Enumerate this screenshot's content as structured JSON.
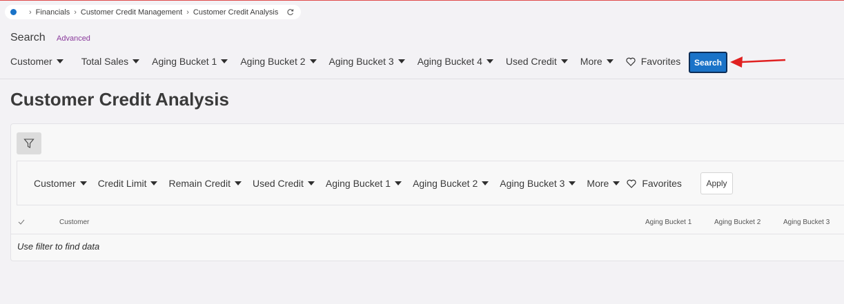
{
  "breadcrumb": {
    "items": [
      "Financials",
      "Customer Credit Management",
      "Customer Credit Analysis"
    ]
  },
  "search": {
    "title": "Search",
    "advanced_label": "Advanced",
    "filters": [
      "Customer",
      "Total Sales",
      "Aging Bucket 1",
      "Aging Bucket 2",
      "Aging Bucket 3",
      "Aging Bucket 4",
      "Used Credit",
      "More"
    ],
    "favorites_label": "Favorites",
    "search_button": "Search"
  },
  "page": {
    "title": "Customer Credit Analysis"
  },
  "card": {
    "filters": [
      "Customer",
      "Credit Limit",
      "Remain Credit",
      "Used Credit",
      "Aging Bucket 1",
      "Aging Bucket 2",
      "Aging Bucket 3",
      "More"
    ],
    "favorites_label": "Favorites",
    "apply_button": "Apply",
    "columns": [
      "Customer",
      "Aging Bucket 1",
      "Aging Bucket 2",
      "Aging Bucket 3"
    ],
    "empty_message": "Use filter to find data"
  },
  "colors": {
    "primary": "#1a73c8",
    "annotation_arrow": "#e02020",
    "advanced_link": "#8a3a9c"
  }
}
